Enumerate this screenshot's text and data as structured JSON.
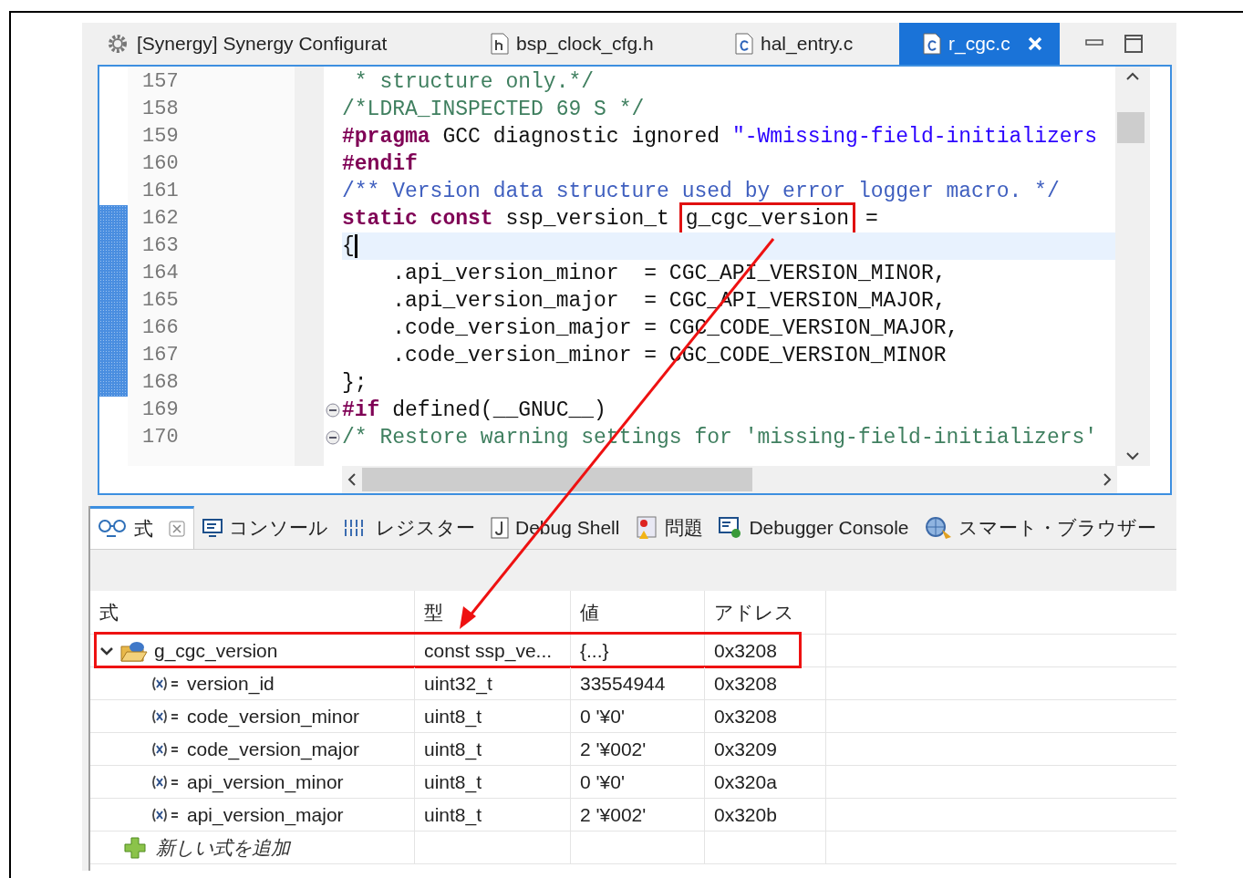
{
  "editor_tabs": [
    {
      "label": "[Synergy] Synergy Configurat",
      "selected": false,
      "closable": false
    },
    {
      "label": "bsp_clock_cfg.h",
      "selected": false,
      "closable": false
    },
    {
      "label": "hal_entry.c",
      "selected": false,
      "closable": false
    },
    {
      "label": "r_cgc.c",
      "selected": true,
      "closable": true
    }
  ],
  "code": {
    "lines": [
      {
        "number": "157",
        "marked": false,
        "current": false,
        "fold": false,
        "segments": [
          {
            "kind": "comment",
            "text": " * structure only.*/"
          }
        ]
      },
      {
        "number": "158",
        "marked": false,
        "current": false,
        "fold": false,
        "segments": [
          {
            "kind": "comment",
            "text": "/*LDRA_INSPECTED 69 S */"
          }
        ]
      },
      {
        "number": "159",
        "marked": false,
        "current": false,
        "fold": false,
        "segments": [
          {
            "kind": "keyword",
            "text": "#pragma"
          },
          {
            "kind": "plain",
            "text": " GCC diagnostic ignored "
          },
          {
            "kind": "string",
            "text": "\"-Wmissing-field-initializers"
          }
        ]
      },
      {
        "number": "160",
        "marked": false,
        "current": false,
        "fold": false,
        "segments": [
          {
            "kind": "keyword",
            "text": "#endif"
          }
        ]
      },
      {
        "number": "161",
        "marked": false,
        "current": false,
        "fold": false,
        "segments": [
          {
            "kind": "doc",
            "text": "/** Version data structure used by error logger macro. */"
          }
        ]
      },
      {
        "number": "162",
        "marked": true,
        "current": false,
        "fold": false,
        "segments": [
          {
            "kind": "keyword",
            "text": "static const"
          },
          {
            "kind": "plain",
            "text": " ssp_version_t "
          },
          {
            "kind": "boxed",
            "text": "g_cgc_version"
          },
          {
            "kind": "plain",
            "text": " ="
          }
        ]
      },
      {
        "number": "163",
        "marked": true,
        "current": true,
        "fold": false,
        "segments": [
          {
            "kind": "plain",
            "text": "{"
          }
        ]
      },
      {
        "number": "164",
        "marked": true,
        "current": false,
        "fold": false,
        "segments": [
          {
            "kind": "plain",
            "text": "    .api_version_minor  = CGC_API_VERSION_MINOR,"
          }
        ]
      },
      {
        "number": "165",
        "marked": true,
        "current": false,
        "fold": false,
        "segments": [
          {
            "kind": "plain",
            "text": "    .api_version_major  = CGC_API_VERSION_MAJOR,"
          }
        ]
      },
      {
        "number": "166",
        "marked": true,
        "current": false,
        "fold": false,
        "segments": [
          {
            "kind": "plain",
            "text": "    .code_version_major = CGC_CODE_VERSION_MAJOR,"
          }
        ]
      },
      {
        "number": "167",
        "marked": true,
        "current": false,
        "fold": false,
        "segments": [
          {
            "kind": "plain",
            "text": "    .code_version_minor = CGC_CODE_VERSION_MINOR"
          }
        ]
      },
      {
        "number": "168",
        "marked": true,
        "current": false,
        "fold": false,
        "segments": [
          {
            "kind": "plain",
            "text": "};"
          }
        ]
      },
      {
        "number": "169",
        "marked": false,
        "current": false,
        "fold": true,
        "segments": [
          {
            "kind": "keyword",
            "text": "#if"
          },
          {
            "kind": "plain",
            "text": " defined(__GNUC__)"
          }
        ]
      },
      {
        "number": "170",
        "marked": false,
        "current": false,
        "fold": true,
        "segments": [
          {
            "kind": "comment",
            "text": "/* Restore warning settings for 'missing-field-initializers'"
          }
        ]
      }
    ]
  },
  "panel_tabs": [
    {
      "label": "式",
      "selected": true,
      "closable": true
    },
    {
      "label": "コンソール",
      "selected": false,
      "closable": false
    },
    {
      "label": "レジスター",
      "selected": false,
      "closable": false
    },
    {
      "label": "Debug Shell",
      "selected": false,
      "closable": false
    },
    {
      "label": "問題",
      "selected": false,
      "closable": false
    },
    {
      "label": "Debugger Console",
      "selected": false,
      "closable": false
    },
    {
      "label": "スマート・ブラウザー",
      "selected": false,
      "closable": false
    }
  ],
  "table": {
    "columns": [
      "式",
      "型",
      "値",
      "アドレス"
    ],
    "rows": [
      {
        "name": "g_cgc_version",
        "type": "const ssp_ve...",
        "value": "{...}",
        "address": "0x3208",
        "expanded": true,
        "boxed": true,
        "children": [
          {
            "name": "version_id",
            "type": "uint32_t",
            "value": "33554944",
            "address": "0x3208"
          },
          {
            "name": "code_version_minor",
            "type": "uint8_t",
            "value": "0 '¥0'",
            "address": "0x3208"
          },
          {
            "name": "code_version_major",
            "type": "uint8_t",
            "value": "2 '¥002'",
            "address": "0x3209"
          },
          {
            "name": "api_version_minor",
            "type": "uint8_t",
            "value": "0 '¥0'",
            "address": "0x320a"
          },
          {
            "name": "api_version_major",
            "type": "uint8_t",
            "value": "2 '¥002'",
            "address": "0x320b"
          }
        ]
      }
    ],
    "add_row": "新しい式を追加"
  }
}
